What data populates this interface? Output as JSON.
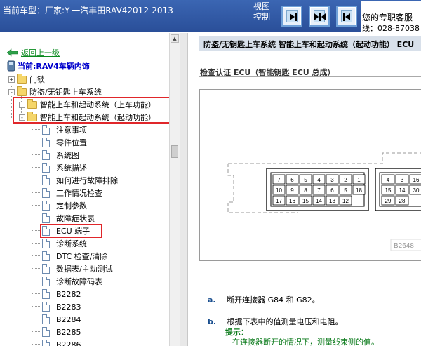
{
  "header": {
    "car_title": "当前车型：厂家:Y-一汽丰田RAV42012-2013",
    "view_label": "视图控制",
    "buttons": [
      {
        "name": "collapse-left-button",
        "icon": "arrow-right-bar"
      },
      {
        "name": "center-split-button",
        "icon": "arrows-inward"
      },
      {
        "name": "collapse-right-button",
        "icon": "arrow-left-bar"
      }
    ],
    "contact_line1": "您的专职客服",
    "contact_line2": "线：028-87038"
  },
  "tree": {
    "back_label": "返回上一级",
    "current_label": "当前:RAV4车辆内饰",
    "items": [
      {
        "label": "门锁",
        "type": "folder",
        "expander": "+"
      },
      {
        "label": "防盗/无钥匙上车系统",
        "type": "folder",
        "expander": "-"
      },
      {
        "label": "智能上车和起动系统（上车功能）",
        "type": "folder",
        "expander": "+"
      },
      {
        "label": "智能上车和起动系统（起动功能）",
        "type": "folder",
        "expander": "-"
      },
      {
        "label": "注意事项",
        "type": "doc"
      },
      {
        "label": "零件位置",
        "type": "doc"
      },
      {
        "label": "系统图",
        "type": "doc"
      },
      {
        "label": "系统描述",
        "type": "doc"
      },
      {
        "label": "如何进行故障排除",
        "type": "doc"
      },
      {
        "label": "工作情况检查",
        "type": "doc"
      },
      {
        "label": "定制参数",
        "type": "doc"
      },
      {
        "label": "故障症状表",
        "type": "doc"
      },
      {
        "label": "ECU 端子",
        "type": "doc"
      },
      {
        "label": "诊断系统",
        "type": "doc"
      },
      {
        "label": "DTC 检查/清除",
        "type": "doc"
      },
      {
        "label": "数据表/主动测试",
        "type": "doc"
      },
      {
        "label": "诊断故障码表",
        "type": "doc"
      },
      {
        "label": "B2282",
        "type": "doc"
      },
      {
        "label": "B2283",
        "type": "doc"
      },
      {
        "label": "B2284",
        "type": "doc"
      },
      {
        "label": "B2285",
        "type": "doc"
      },
      {
        "label": "B2286",
        "type": "doc"
      }
    ]
  },
  "content": {
    "title": "防盗/无钥匙上车系统  智能上车和起动系统（起动功能）  ECU",
    "section_title": "检查认证 ECU（智能钥匙 ECU 总成）",
    "connector_left_pins": [
      "7",
      "6",
      "5",
      "4",
      "3",
      "2",
      "1",
      "10",
      "9",
      "8",
      "7",
      "6",
      "5",
      "18",
      "17",
      "16",
      "15",
      "14",
      "13",
      "12"
    ],
    "connector_right_pins": [
      "4",
      "3",
      "16",
      "15",
      "14",
      "30",
      "29",
      "28"
    ],
    "diagram_code": "B2648",
    "step_a_letter": "a.",
    "step_a_text": "断开连接器 G84 和 G82。",
    "step_b_letter": "b.",
    "step_b_text": "根据下表中的值测量电压和电阻。",
    "tip_label": "提示：",
    "tip_text": "在连接器断开的情况下，测量线束侧的值。"
  },
  "colors": {
    "header_bg": "#2f5aa6",
    "highlight_box": "#e0262a",
    "link_green": "#0a8a1f",
    "current_blue": "#0000cc",
    "step_letter": "#1a4f8f"
  }
}
